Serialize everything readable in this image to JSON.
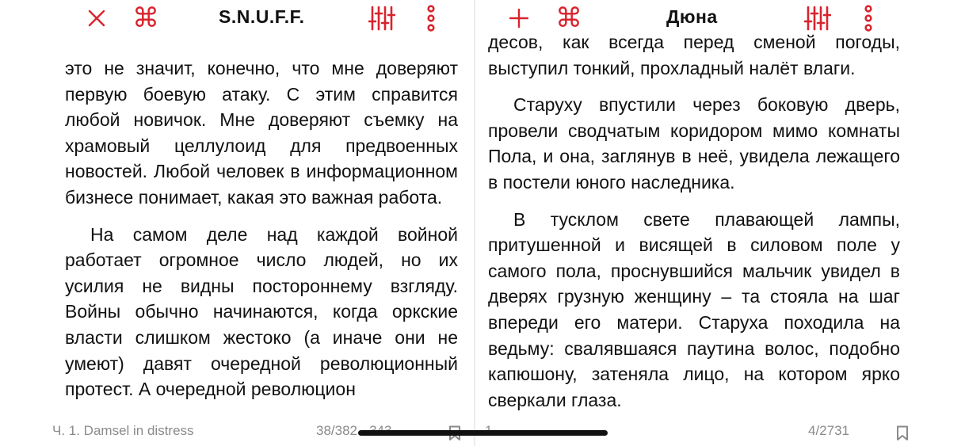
{
  "left": {
    "title": "S.N.U.F.F.",
    "icons": {
      "close": "close-icon",
      "command": "command-icon",
      "settings": "sliders-icon",
      "menu": "more-vertical-icon"
    },
    "command_glyph": "⌘",
    "paragraphs": [
      "это не значит, конечно, что мне доверяют первую боевую атаку. С этим справится любой новичок. Мне доверяют съемку на храмовый целлулоид для предвоенных новостей. Любой человек в информационном бизнесе понимает, какая это важная работа.",
      "На самом деле над каждой войной работает огромное число людей, но их усилия не видны постороннему взгляду. Войны обычно начинаются, когда оркские власти слишком жестоко (а иначе они не умеют) давят очередной революционный протест. А очередной революцион"
    ],
    "footer": {
      "chapter": "Ч. 1. Damsel in distress",
      "pages": "38/382 - 343"
    }
  },
  "right": {
    "title": "Дюна",
    "icons": {
      "add": "plus-icon",
      "command": "command-icon",
      "settings": "sliders-icon",
      "menu": "more-vertical-icon"
    },
    "command_glyph": "⌘",
    "paragraphs": [
      "десов, как всегда перед сменой погоды, выступил тонкий, прохладный налёт влаги.",
      "Старуху впустили через боковую дверь, провели сводчатым коридором мимо комнаты Пола, и она, заглянув в неё, увидела лежащего в постели юного наследника.",
      "В тусклом свете плавающей лампы, притушенной и висящей в силовом поле у самого пола, проснувшийся мальчик увидел в дверях грузную женщину – та стояла на шаг впереди его матери. Старуха походила на ведьму: свалявшаяся паутина волос, подобно капюшону, затеняла лицо, на котором ярко сверкали глаза."
    ],
    "footer": {
      "left_page": "1",
      "pages": "4/2731"
    }
  },
  "colors": {
    "accent": "#d9232d",
    "footer_text": "#8a8a8a"
  }
}
